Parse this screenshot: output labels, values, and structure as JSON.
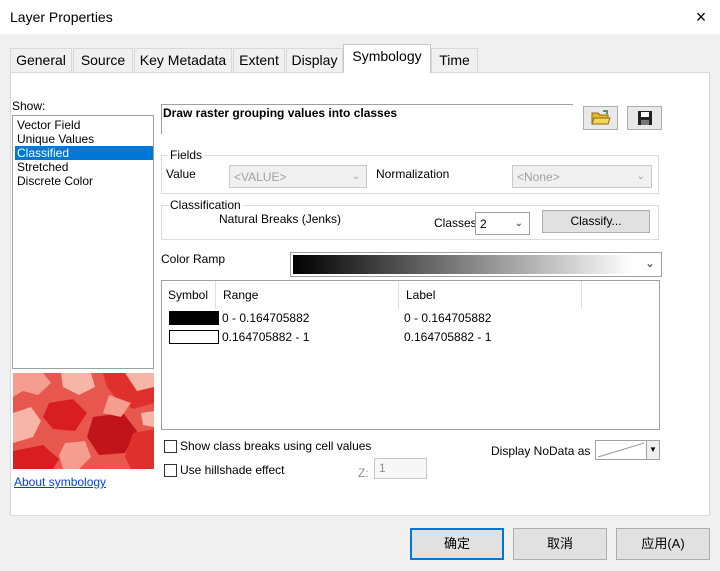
{
  "window": {
    "title": "Layer Properties",
    "close_glyph": "×"
  },
  "tabs": [
    {
      "label": "General"
    },
    {
      "label": "Source"
    },
    {
      "label": "Key Metadata"
    },
    {
      "label": "Extent"
    },
    {
      "label": "Display"
    },
    {
      "label": "Symbology",
      "active": true
    },
    {
      "label": "Time"
    }
  ],
  "show": {
    "label": "Show:",
    "items": [
      "Vector Field",
      "Unique Values",
      "Classified",
      "Stretched",
      "Discrete Color"
    ],
    "selected": "Classified",
    "about_link": "About symbology"
  },
  "heading": {
    "text": "Draw raster grouping values into classes",
    "open_icon": "folder-open-icon",
    "save_icon": "save-icon"
  },
  "fields": {
    "group_label": "Fields",
    "value_label": "Value",
    "value_selected": "<VALUE>",
    "normalization_label": "Normalization",
    "normalization_selected": "<None>"
  },
  "classification": {
    "group_label": "Classification",
    "method": "Natural Breaks (Jenks)",
    "classes_label": "Classes",
    "classes_value": "2",
    "classify_button": "Classify..."
  },
  "color_ramp": {
    "label": "Color Ramp",
    "from": "#000000",
    "to": "#ffffff"
  },
  "table": {
    "headers": [
      "Symbol",
      "Range",
      "Label"
    ],
    "rows": [
      {
        "color": "#000000",
        "range": "0 - 0.164705882",
        "label": "0 - 0.164705882"
      },
      {
        "color": "#ffffff",
        "range": "0.164705882 - 1",
        "label": "0.164705882 - 1"
      }
    ]
  },
  "options": {
    "show_breaks_label": "Show class breaks using cell values",
    "hillshade_label": "Use hillshade effect",
    "z_label": "Z:",
    "z_value": "1",
    "nodata_label": "Display NoData as"
  },
  "footer": {
    "ok": "确定",
    "cancel": "取消",
    "apply": "应用(A)"
  }
}
